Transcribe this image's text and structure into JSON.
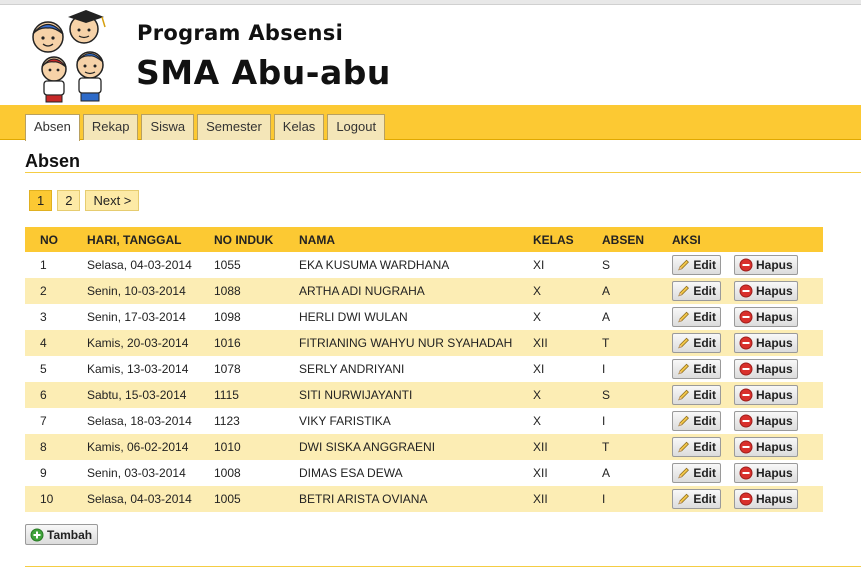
{
  "app": {
    "title_line1": "Program Absensi",
    "title_line2": "SMA Abu-abu"
  },
  "nav": {
    "tabs": [
      {
        "label": "Absen",
        "active": true
      },
      {
        "label": "Rekap",
        "active": false
      },
      {
        "label": "Siswa",
        "active": false
      },
      {
        "label": "Semester",
        "active": false
      },
      {
        "label": "Kelas",
        "active": false
      },
      {
        "label": "Logout",
        "active": false
      }
    ]
  },
  "page": {
    "title": "Absen"
  },
  "pager": {
    "pages": [
      "1",
      "2"
    ],
    "current": "1",
    "next_label": "Next >"
  },
  "table": {
    "headers": [
      "NO",
      "HARI, TANGGAL",
      "NO INDUK",
      "NAMA",
      "KELAS",
      "ABSEN",
      "AKSI"
    ],
    "rows": [
      {
        "no": "1",
        "date": "Selasa, 04-03-2014",
        "induk": "1055",
        "nama": "EKA KUSUMA WARDHANA",
        "kelas": "XI",
        "absen": "S"
      },
      {
        "no": "2",
        "date": "Senin, 10-03-2014",
        "induk": "1088",
        "nama": "ARTHA ADI NUGRAHA",
        "kelas": "X",
        "absen": "A"
      },
      {
        "no": "3",
        "date": "Senin, 17-03-2014",
        "induk": "1098",
        "nama": "HERLI DWI WULAN",
        "kelas": "X",
        "absen": "A"
      },
      {
        "no": "4",
        "date": "Kamis, 20-03-2014",
        "induk": "1016",
        "nama": "FITRIANING WAHYU NUR SYAHADAH",
        "kelas": "XII",
        "absen": "T"
      },
      {
        "no": "5",
        "date": "Kamis, 13-03-2014",
        "induk": "1078",
        "nama": "SERLY ANDRIYANI",
        "kelas": "XI",
        "absen": "I"
      },
      {
        "no": "6",
        "date": "Sabtu, 15-03-2014",
        "induk": "1115",
        "nama": "SITI NURWIJAYANTI",
        "kelas": "X",
        "absen": "S"
      },
      {
        "no": "7",
        "date": "Selasa, 18-03-2014",
        "induk": "1123",
        "nama": "VIKY FARISTIKA",
        "kelas": "X",
        "absen": "I"
      },
      {
        "no": "8",
        "date": "Kamis, 06-02-2014",
        "induk": "1010",
        "nama": "DWI SISKA ANGGRAENI",
        "kelas": "XII",
        "absen": "T"
      },
      {
        "no": "9",
        "date": "Senin, 03-03-2014",
        "induk": "1008",
        "nama": "DIMAS ESA DEWA",
        "kelas": "XII",
        "absen": "A"
      },
      {
        "no": "10",
        "date": "Selasa, 04-03-2014",
        "induk": "1005",
        "nama": "BETRI ARISTA OVIANA",
        "kelas": "XII",
        "absen": "I"
      }
    ],
    "edit_label": "Edit",
    "delete_label": "Hapus",
    "icons": {
      "edit": "pencil-icon",
      "delete": "minus-circle-icon"
    }
  },
  "actions": {
    "add_label": "Tambah",
    "add_icon": "plus-circle-icon"
  },
  "colors": {
    "accent": "#fcc933",
    "row_alt": "#fcedb4",
    "delete_red": "#d9302c",
    "add_green": "#3fa33a"
  }
}
